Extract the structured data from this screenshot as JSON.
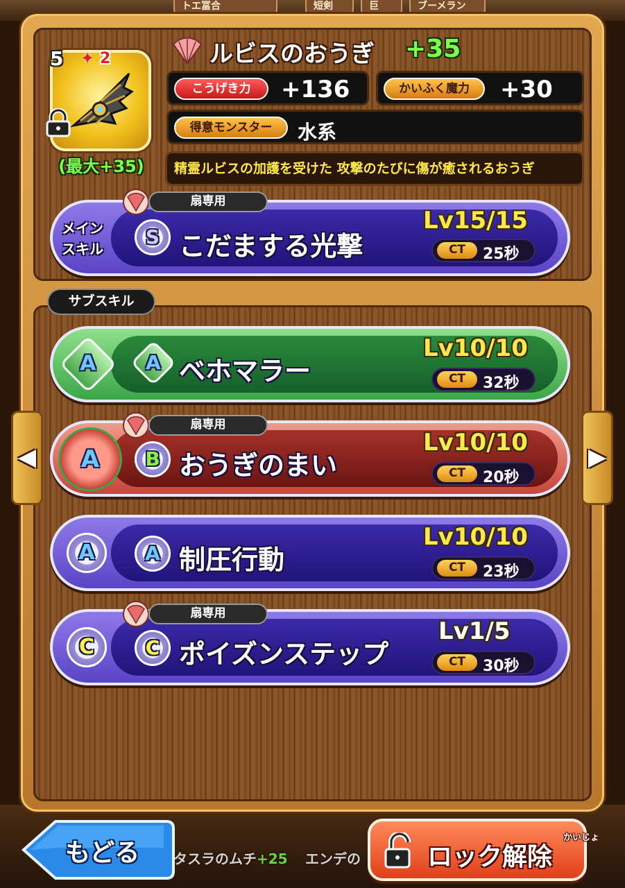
{
  "background": {
    "top_tabs": [
      "トエ冨合",
      "短剣",
      "巨",
      "ブーメラン"
    ],
    "bottom_items": [
      {
        "name": "タスラのムチ",
        "plus": "+25"
      },
      {
        "name": "エンデの"
      }
    ]
  },
  "item": {
    "rarity": "5",
    "awaken": "2",
    "name": "ルビスのおうぎ",
    "plus": "+35",
    "max_plus": "(最大+35)",
    "stats": [
      {
        "label": "こうげき力",
        "value": "+136",
        "color": "#d81f1f"
      },
      {
        "label": "かいふく魔力",
        "value": "+30",
        "color": "#e08a10"
      }
    ],
    "favored": {
      "label": "得意モンスター",
      "value": "水系"
    },
    "description": "精霊ルビスの加護を受けた 攻撃のたびに傷が癒されるおうぎ"
  },
  "main_skill": {
    "section_label_1": "メイン",
    "section_label_2": "スキル",
    "tag": "扇専用",
    "rank": "S",
    "name": "こだまする光撃",
    "level": "Lv15/15",
    "ct_label": "CT",
    "ct": "25秒"
  },
  "sub_skill_label": "サブスキル",
  "sub_skills": [
    {
      "slot": "A",
      "rank": "A",
      "name": "ベホマラー",
      "level": "Lv10/10",
      "ct_label": "CT",
      "ct": "32秒",
      "tag": "",
      "color": "green"
    },
    {
      "slot": "A",
      "rank": "B",
      "name": "おうぎのまい",
      "level": "Lv10/10",
      "ct_label": "CT",
      "ct": "20秒",
      "tag": "扇専用",
      "color": "red"
    },
    {
      "slot": "A",
      "rank": "A",
      "name": "制圧行動",
      "level": "Lv10/10",
      "ct_label": "CT",
      "ct": "23秒",
      "tag": "",
      "color": "purple"
    },
    {
      "slot": "C",
      "rank": "C",
      "name": "ポイズンステップ",
      "level": "Lv1/5",
      "ct_label": "CT",
      "ct": "30秒",
      "tag": "扇専用",
      "color": "purple"
    }
  ],
  "nav": {
    "prev": "◀",
    "next": "▶"
  },
  "buttons": {
    "back": "もどる",
    "unlock": "ロック解除",
    "unlock_ruby": "かいじょ"
  },
  "icons": [
    "lock-icon",
    "fan-icon",
    "weapon-fan-icon",
    "padlock-open-icon"
  ]
}
